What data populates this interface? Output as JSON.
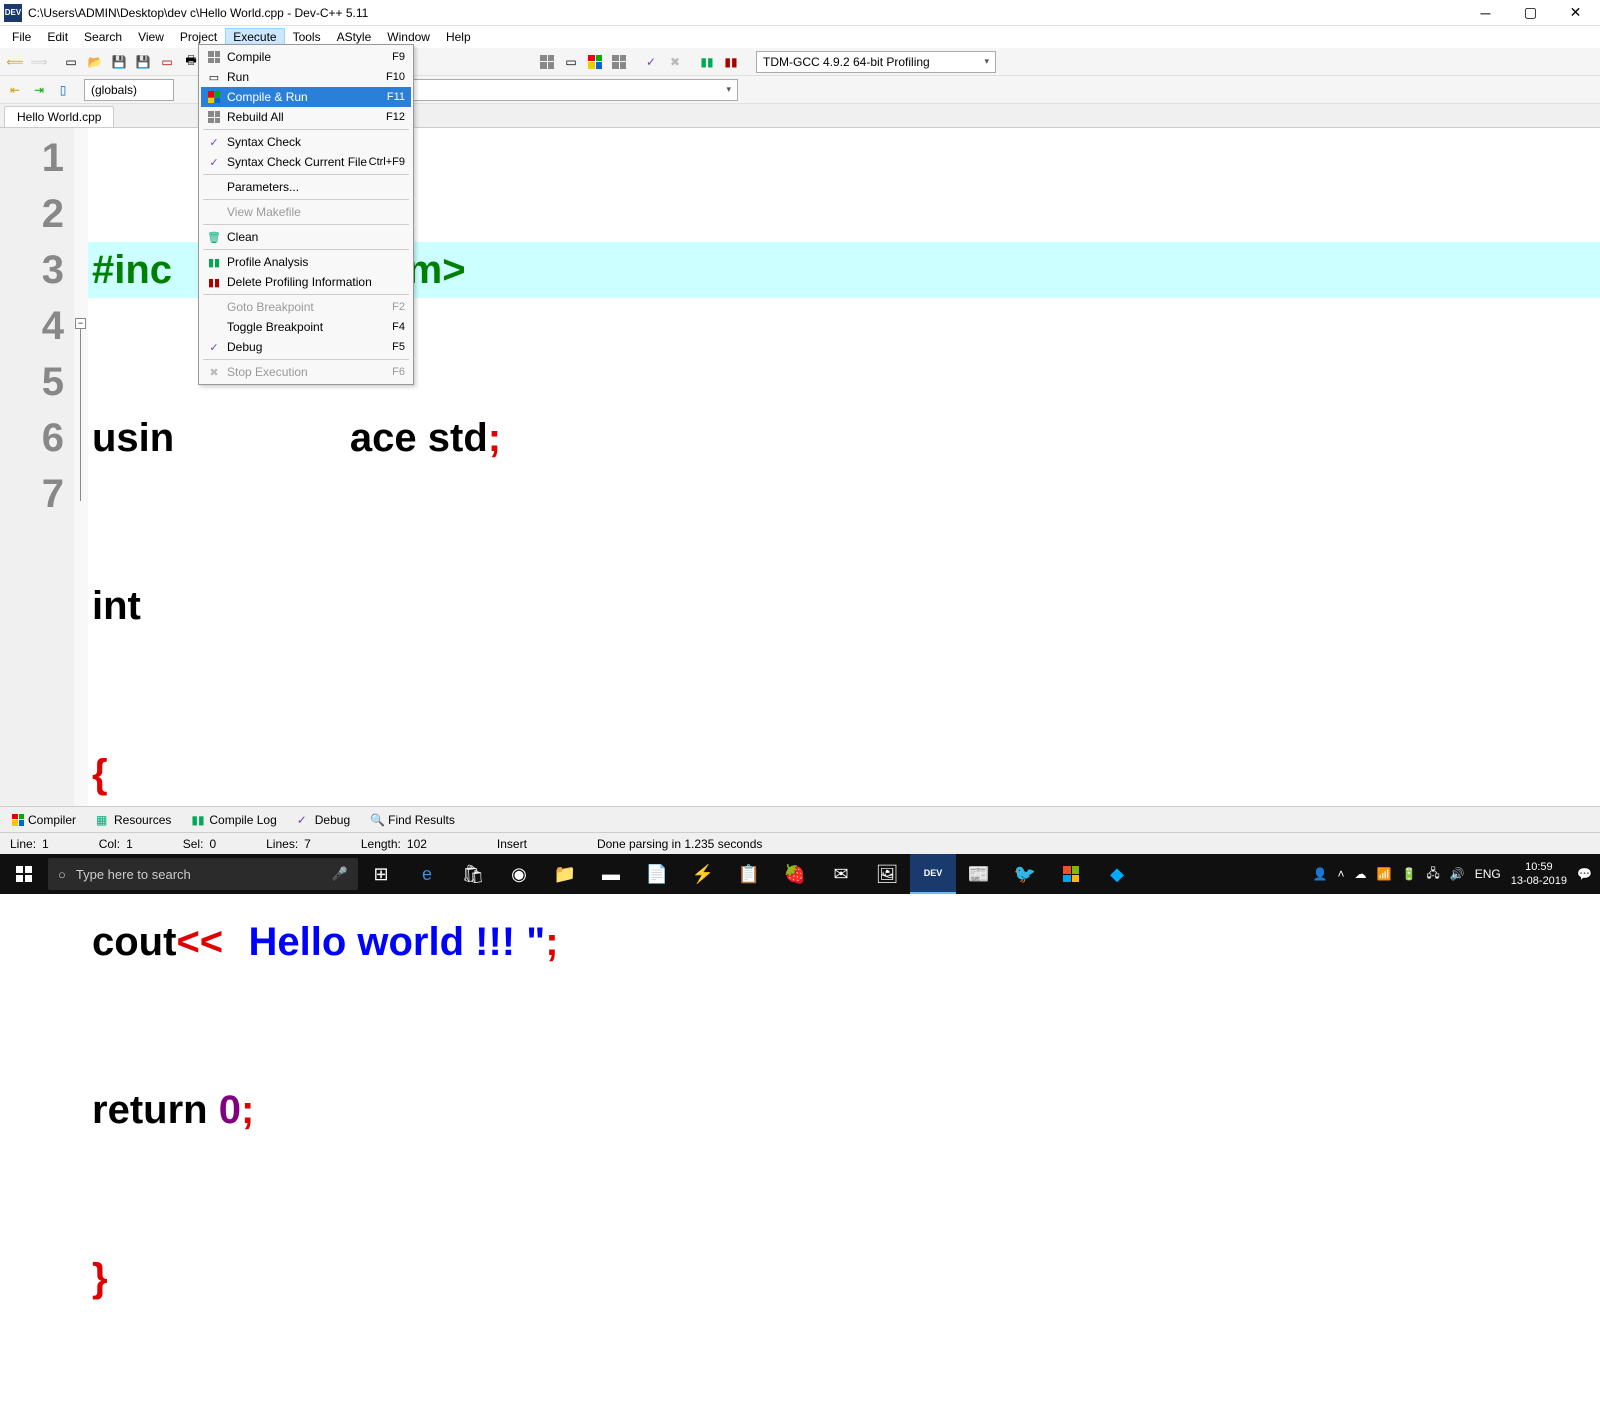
{
  "title": "C:\\Users\\ADMIN\\Desktop\\dev c\\Hello World.cpp - Dev-C++ 5.11",
  "menubar": [
    "File",
    "Edit",
    "Search",
    "View",
    "Project",
    "Execute",
    "Tools",
    "AStyle",
    "Window",
    "Help"
  ],
  "toolbar2": {
    "globals": "(globals)"
  },
  "compiler_combo": "TDM-GCC 4.9.2 64-bit Profiling",
  "tab": "Hello World.cpp",
  "dropdown": {
    "items": [
      {
        "label": "Compile",
        "shortcut": "F9",
        "icon": "grid"
      },
      {
        "label": "Run",
        "shortcut": "F10",
        "icon": "box"
      },
      {
        "label": "Compile & Run",
        "shortcut": "F11",
        "icon": "grid-color",
        "selected": true
      },
      {
        "label": "Rebuild All",
        "shortcut": "F12",
        "icon": "grid"
      },
      {
        "sep": true
      },
      {
        "label": "Syntax Check",
        "icon": "check"
      },
      {
        "label": "Syntax Check Current File",
        "shortcut": "Ctrl+F9",
        "icon": "check"
      },
      {
        "sep": true
      },
      {
        "label": "Parameters..."
      },
      {
        "sep": true
      },
      {
        "label": "View Makefile",
        "disabled": true
      },
      {
        "sep": true
      },
      {
        "label": "Clean",
        "icon": "trash"
      },
      {
        "sep": true
      },
      {
        "label": "Profile Analysis",
        "icon": "bars"
      },
      {
        "label": "Delete Profiling Information",
        "icon": "bars-x"
      },
      {
        "sep": true
      },
      {
        "label": "Goto Breakpoint",
        "shortcut": "F2",
        "disabled": true
      },
      {
        "label": "Toggle Breakpoint",
        "shortcut": "F4"
      },
      {
        "label": "Debug",
        "shortcut": "F5",
        "icon": "check"
      },
      {
        "sep": true
      },
      {
        "label": "Stop Execution",
        "shortcut": "F6",
        "disabled": true,
        "icon": "x"
      }
    ]
  },
  "code": {
    "l1a": "#inc",
    "l1b": "tream>",
    "l2a": "usin",
    "l2b": "ace ",
    "l2c": "std",
    "l2d": ";",
    "l3a": "int",
    "l4": "{",
    "l5a": "cout",
    "l5b": "<<",
    "l5c": "Hello world !!! ",
    "l5d": ";",
    "l6a": "return ",
    "l6b": "0",
    "l6c": ";",
    "l7": "}"
  },
  "bottom_tabs": [
    "Compiler",
    "Resources",
    "Compile Log",
    "Debug",
    "Find Results"
  ],
  "status": {
    "line_lbl": "Line:",
    "line": "1",
    "col_lbl": "Col:",
    "col": "1",
    "sel_lbl": "Sel:",
    "sel": "0",
    "lines_lbl": "Lines:",
    "lines": "7",
    "len_lbl": "Length:",
    "len": "102",
    "mode": "Insert",
    "msg": "Done parsing in 1.235 seconds"
  },
  "taskbar": {
    "search_placeholder": "Type here to search",
    "lang": "ENG",
    "time": "10:59",
    "date": "13-08-2019"
  }
}
